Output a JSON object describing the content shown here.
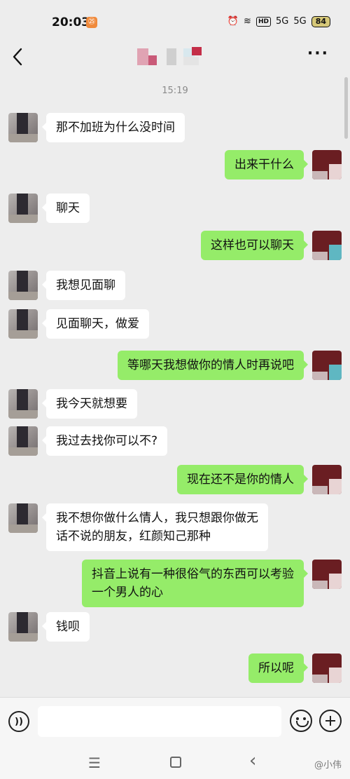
{
  "status_bar": {
    "time": "20:03",
    "app_badge": "㉕",
    "icons": [
      "alarm-icon",
      "wifi-icon",
      "hd-icon",
      "signal-1-icon",
      "signal-2-icon"
    ],
    "hd_label": "HD",
    "signal_1_label": "5G",
    "signal_2_label": "5G",
    "battery": "84"
  },
  "header": {
    "back_icon": "chevron-left-icon",
    "contact_name_blurred": true,
    "more_label": "···"
  },
  "chat": {
    "timestamp": "15:19",
    "messages": [
      {
        "dir": "in",
        "text": "那不加班为什么没时间"
      },
      {
        "dir": "out",
        "text": "出来干什么"
      },
      {
        "dir": "in",
        "text": "聊天"
      },
      {
        "dir": "out",
        "text": "这样也可以聊天"
      },
      {
        "dir": "in",
        "text": "我想见面聊"
      },
      {
        "dir": "in",
        "text": "见面聊天，做爱"
      },
      {
        "dir": "out",
        "text": "等哪天我想做你的情人时再说吧"
      },
      {
        "dir": "in",
        "text": "我今天就想要"
      },
      {
        "dir": "in",
        "text": "我过去找你可以不?"
      },
      {
        "dir": "out",
        "text": "现在还不是你的情人"
      },
      {
        "dir": "in",
        "text": "我不想你做什么情人，我只想跟你做无\n话不说的朋友，红颜知己那种"
      },
      {
        "dir": "out",
        "text": "抖音上说有一种很俗气的东西可以考验\n一个男人的心"
      },
      {
        "dir": "in",
        "text": "钱呗"
      },
      {
        "dir": "out",
        "text": "所以呢"
      }
    ]
  },
  "input_bar": {
    "voice_label": "))",
    "message_value": ""
  },
  "nav_bar": {
    "menu_label": "☰",
    "back_label": "‹",
    "watermark": "@小伟"
  },
  "colors": {
    "background": "#ededed",
    "incoming_bubble": "#ffffff",
    "outgoing_bubble": "#95ec69"
  }
}
